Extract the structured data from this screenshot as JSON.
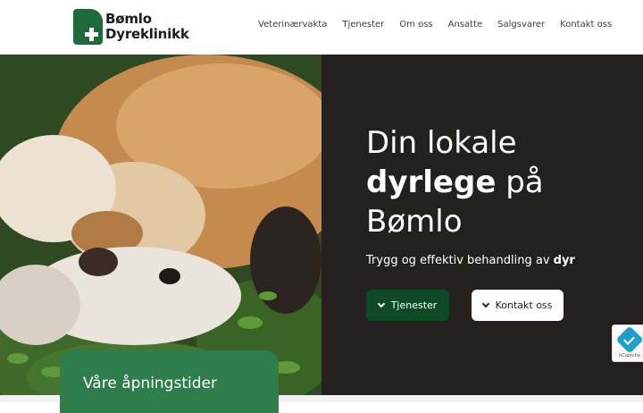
{
  "brand": {
    "name_line1": "Bømlo",
    "name_line2": "Dyreklinikk",
    "color": "#1f6a3a"
  },
  "nav": {
    "items": [
      "Veterinærvakta",
      "Tjenester",
      "Om oss",
      "Ansatte",
      "Salgsvarer",
      "Kontakt oss"
    ]
  },
  "hero": {
    "title_line1": "Din lokale",
    "title_bold": "dyrlege",
    "title_after_bold": " på",
    "title_line3": "Bømlo",
    "subtitle_text": "Trygg og effektiv behandling av ",
    "subtitle_bold": "dyr",
    "image_alt": "cat-and-dog-photo",
    "background": "#252020"
  },
  "buttons": {
    "services_label": "Tjenester",
    "contact_label": "Kontakt oss",
    "services_color": "#0d4a24"
  },
  "hours_card": {
    "title": "Våre åpningstider",
    "color": "#2e7d4a"
  },
  "captcha": {
    "label": "hCaptcha"
  }
}
